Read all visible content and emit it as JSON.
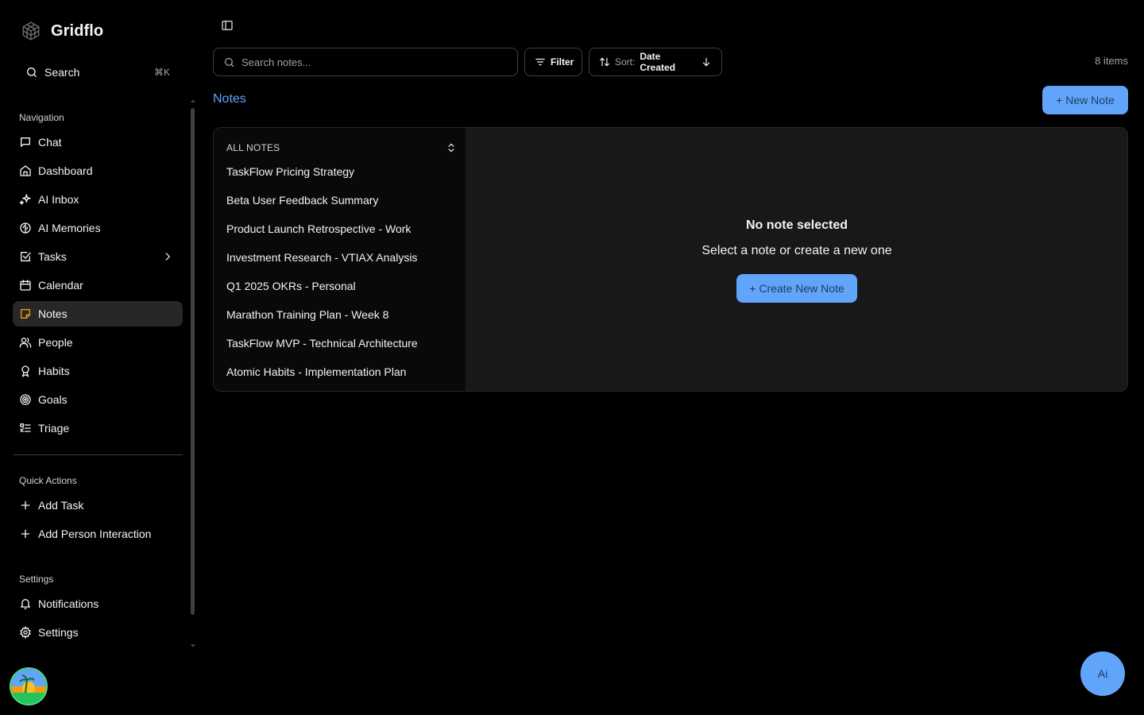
{
  "brand": {
    "name": "Gridflo",
    "logo_icon": "cube-grid-icon"
  },
  "sidebar": {
    "search": {
      "label": "Search",
      "shortcut": "⌘K"
    },
    "navigation_label": "Navigation",
    "nav_items": [
      {
        "label": "Chat",
        "icon": "message-square-icon"
      },
      {
        "label": "Dashboard",
        "icon": "home-icon"
      },
      {
        "label": "AI Inbox",
        "icon": "sparkles-icon"
      },
      {
        "label": "AI Memories",
        "icon": "brain-icon"
      },
      {
        "label": "Tasks",
        "icon": "check-square-icon"
      },
      {
        "label": "Calendar",
        "icon": "calendar-icon"
      },
      {
        "label": "Notes",
        "icon": "sticky-note-icon",
        "active": true
      },
      {
        "label": "People",
        "icon": "users-icon"
      },
      {
        "label": "Habits",
        "icon": "award-icon"
      },
      {
        "label": "Goals",
        "icon": "target-icon"
      },
      {
        "label": "Triage",
        "icon": "list-todo-icon"
      }
    ],
    "quick_actions_label": "Quick Actions",
    "quick_actions": [
      {
        "label": "Add Task",
        "icon": "plus-icon"
      },
      {
        "label": "Add Person Interaction",
        "icon": "plus-icon"
      }
    ],
    "settings_label": "Settings",
    "settings_items": [
      {
        "label": "Notifications",
        "icon": "bell-icon"
      },
      {
        "label": "Settings",
        "icon": "gear-icon"
      }
    ]
  },
  "toolbar": {
    "search_placeholder": "Search notes...",
    "filter_label": "Filter",
    "sort_prefix": "Sort:",
    "sort_value": "Date Created",
    "items_count": "8 items"
  },
  "page": {
    "title": "Notes",
    "new_note_label": "+ New Note"
  },
  "notes_list": {
    "header": "ALL NOTES",
    "items": [
      "TaskFlow Pricing Strategy",
      "Beta User Feedback Summary",
      "Product Launch Retrospective - Work",
      "Investment Research - VTIAX Analysis",
      "Q1 2025 OKRs - Personal",
      "Marathon Training Plan - Week 8",
      "TaskFlow MVP - Technical Architecture",
      "Atomic Habits - Implementation Plan"
    ]
  },
  "empty_state": {
    "title": "No note selected",
    "subtitle": "Select a note or create a new one",
    "button_label": "+ Create New Note"
  },
  "ai_fab": {
    "label": "Ai"
  },
  "colors": {
    "accent": "#60a5fa",
    "bg": "#000000",
    "active": "#27272a"
  }
}
